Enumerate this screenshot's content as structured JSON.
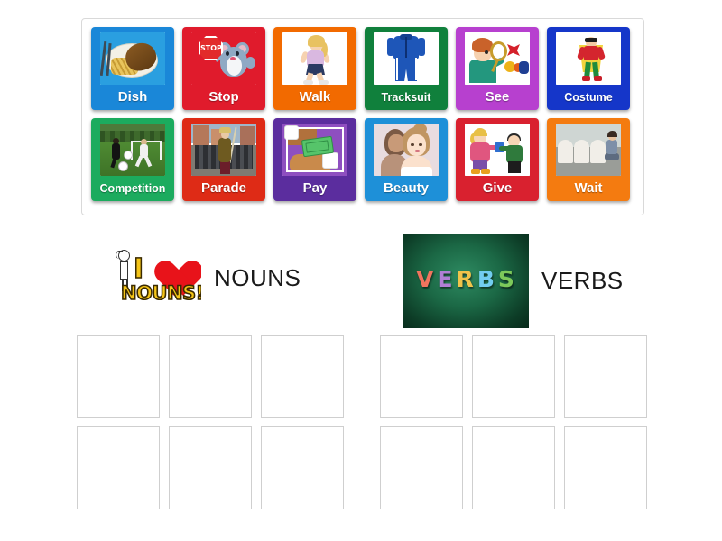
{
  "activity": {
    "type": "group-sort",
    "tray": {
      "tiles": [
        {
          "label": "Dish",
          "color": "#1a87d8",
          "icon": "fish-and-chips-plate-image"
        },
        {
          "label": "Stop",
          "color": "#e01b2c",
          "icon": "mouse-holding-stop-sign-image"
        },
        {
          "label": "Walk",
          "color": "#f26a00",
          "icon": "girl-walking-image"
        },
        {
          "label": "Tracksuit",
          "color": "#10803c",
          "icon": "blue-tracksuit-image"
        },
        {
          "label": "See",
          "color": "#b740cf",
          "icon": "boy-with-magnifying-glass-image"
        },
        {
          "label": "Costume",
          "color": "#1536c9",
          "icon": "superhero-costume-image"
        },
        {
          "label": "Competition",
          "color": "#1cab5e",
          "icon": "football-match-photo"
        },
        {
          "label": "Parade",
          "color": "#de2b16",
          "icon": "marching-band-parade-photo"
        },
        {
          "label": "Pay",
          "color": "#5b2d9e",
          "icon": "hand-giving-money-image"
        },
        {
          "label": "Beauty",
          "color": "#1e90d8",
          "icon": "beautiful-woman-image"
        },
        {
          "label": "Give",
          "color": "#d9212f",
          "icon": "girl-giving-gift-to-boy-image"
        },
        {
          "label": "Wait",
          "color": "#f47b10",
          "icon": "waiting-room-chairs-photo"
        }
      ]
    },
    "categories": [
      {
        "title": "NOUNS",
        "image_name": "i-love-nouns-clipart",
        "image_text": {
          "line1": "I",
          "line2": "NOUNS!"
        },
        "dropzones": 6
      },
      {
        "title": "VERBS",
        "image_name": "verbs-chalkboard-letters-photo",
        "image_text": {
          "letters": [
            "V",
            "E",
            "R",
            "B",
            "S"
          ]
        },
        "letter_colors": [
          "#f0745e",
          "#b07fd4",
          "#f0c44a",
          "#72cdf0",
          "#7cc95a"
        ],
        "dropzones": 6
      }
    ]
  }
}
